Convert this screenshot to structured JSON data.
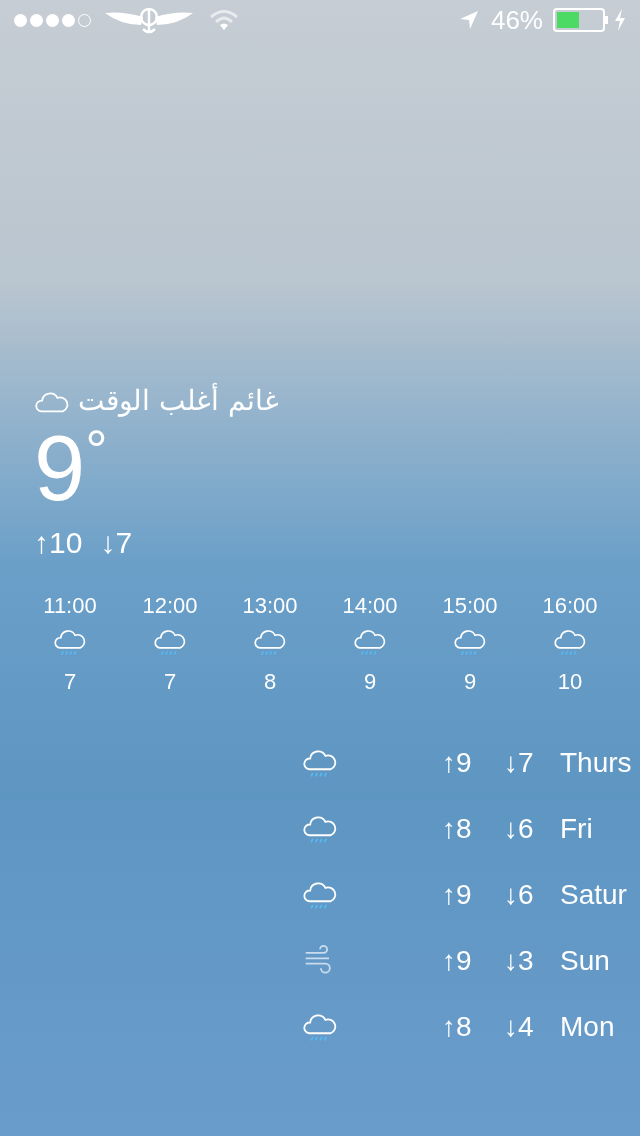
{
  "status_bar": {
    "battery_percent": "46%"
  },
  "current": {
    "condition": "غائم أغلب الوقت",
    "kind": "cloud",
    "temperature": "9",
    "degree": "°",
    "high": "↑10",
    "low": "↓7"
  },
  "hourly": [
    {
      "time": "11:00",
      "kind": "rain",
      "temp": "7"
    },
    {
      "time": "12:00",
      "kind": "rain",
      "temp": "7"
    },
    {
      "time": "13:00",
      "kind": "rain",
      "temp": "8"
    },
    {
      "time": "14:00",
      "kind": "rain",
      "temp": "9"
    },
    {
      "time": "15:00",
      "kind": "rain",
      "temp": "9"
    },
    {
      "time": "16:00",
      "kind": "rain",
      "temp": "10"
    }
  ],
  "daily": [
    {
      "kind": "rain",
      "high": "↑9",
      "low": "↓7",
      "day": "Thurs"
    },
    {
      "kind": "rain",
      "high": "↑8",
      "low": "↓6",
      "day": "Fri"
    },
    {
      "kind": "rain",
      "high": "↑9",
      "low": "↓6",
      "day": "Satur"
    },
    {
      "kind": "wind",
      "high": "↑9",
      "low": "↓3",
      "day": "Sun"
    },
    {
      "kind": "rain",
      "high": "↑8",
      "low": "↓4",
      "day": "Mon"
    }
  ]
}
